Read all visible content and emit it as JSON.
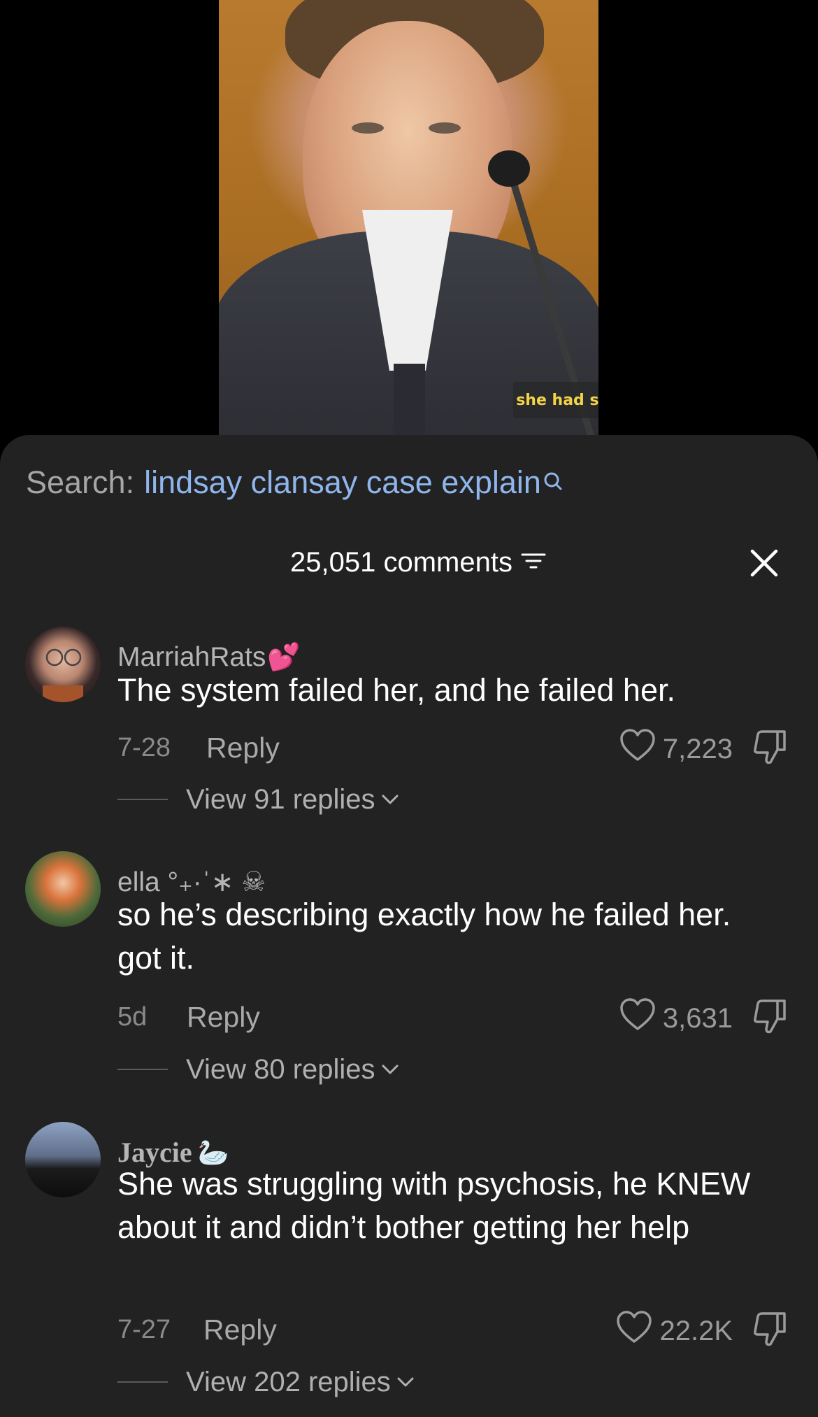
{
  "video": {
    "caption": "she had specific thoughts"
  },
  "search": {
    "label": "Search:",
    "query": "lindsay clansay case explain",
    "icon": "search-icon"
  },
  "header": {
    "count_label": "25,051 comments",
    "filter_icon": "filter-icon",
    "close_icon": "close-icon"
  },
  "comments": [
    {
      "username": "MarriahRats",
      "username_emoji": "💕",
      "text": "The system failed her, and he failed her.",
      "date": "7-28",
      "reply_label": "Reply",
      "likes": "7,223",
      "view_replies": "View 91 replies"
    },
    {
      "username": "ella °₊·ˈ∗ ☠︎",
      "text": "so he’s describing exactly how he failed her. got it.",
      "date": "5d",
      "reply_label": "Reply",
      "likes": "3,631",
      "view_replies": "View 80 replies"
    },
    {
      "username": "Jaycie",
      "username_emoji": "🦢",
      "text": "She was struggling with psychosis, he KNEW about it and didn’t bother getting her help",
      "date": "7-27",
      "reply_label": "Reply",
      "likes": "22.2K",
      "view_replies": "View 202 replies"
    }
  ],
  "colors": {
    "sheet_bg": "#222223",
    "search_query": "#8fb6ec",
    "caption_text": "#f3d34a"
  }
}
